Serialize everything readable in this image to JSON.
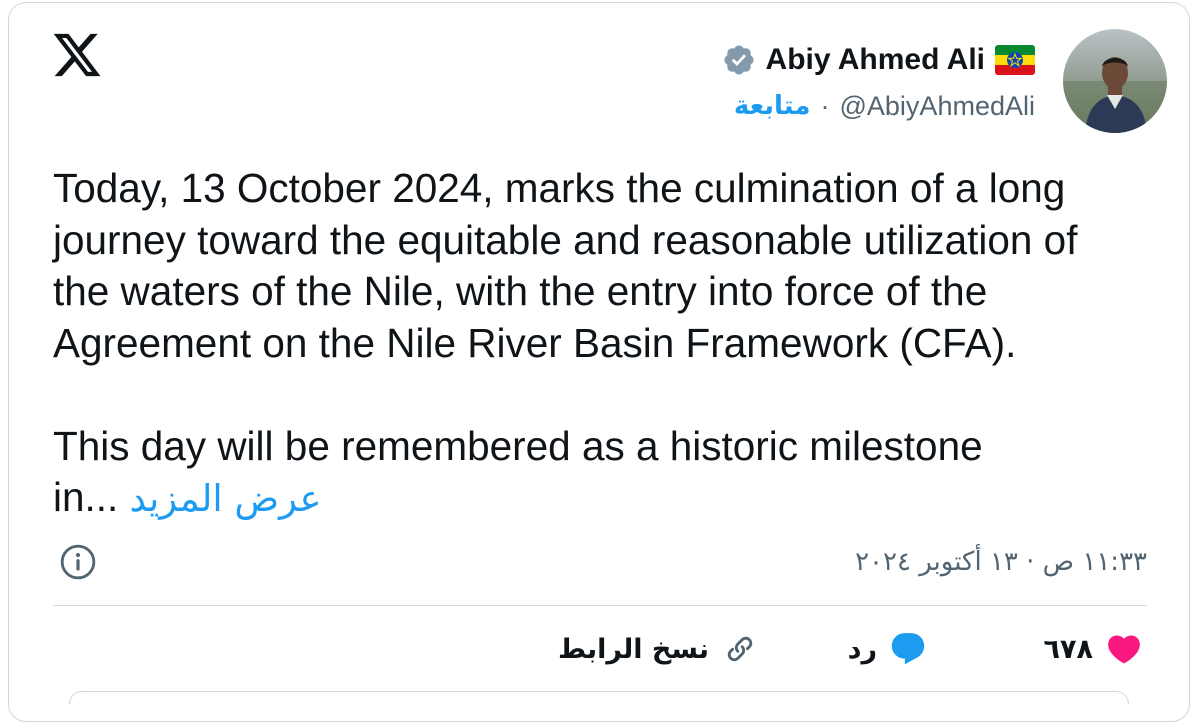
{
  "brand": {
    "logo_icon": "x-logo-icon"
  },
  "author": {
    "display_name": "Abiy Ahmed Ali",
    "handle": "@AbiyAhmedAli",
    "verified_icon": "verified-badge-icon",
    "flag_icon": "ethiopia-flag-icon",
    "follow_label": "متابعة",
    "separator": "·"
  },
  "tweet": {
    "lines_para1": [
      "Today, 13 October 2024, marks the culmination of a long",
      "journey toward the equitable and reasonable utilization of",
      "the waters of the Nile, with the entry into force of the",
      "Agreement on the Nile River Basin Framework (CFA)."
    ],
    "line_para2": "This day will be remembered as a historic milestone",
    "truncated_tail": "in...",
    "show_more_label": "عرض المزيد"
  },
  "meta": {
    "timestamp": "١١:٣٣ ص · ١٣ أكتوبر ٢٠٢٤",
    "info_icon": "info-icon"
  },
  "actions": {
    "like_count": "٦٧٨",
    "reply_label": "رد",
    "copy_link_label": "نسخ الرابط"
  },
  "colors": {
    "accent": "#1d9bf0",
    "like": "#f91880",
    "text": "#0f1419",
    "secondary": "#536471",
    "border": "#cfd9de"
  }
}
